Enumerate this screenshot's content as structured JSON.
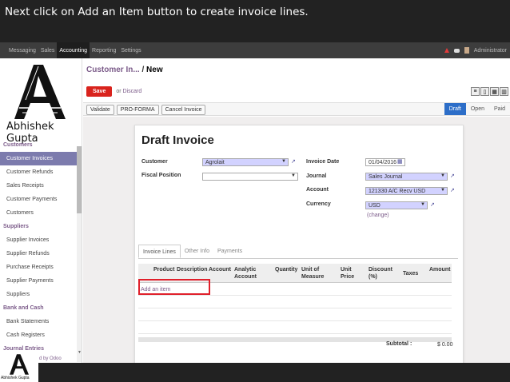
{
  "slide": {
    "instruction": "Next click on Add an Item button to create invoice lines."
  },
  "topbar": {
    "menu": [
      "Messaging",
      "Sales",
      "Accounting",
      "Reporting",
      "Settings"
    ],
    "user": "Administrator"
  },
  "logo": {
    "text": "Abhishek Gupta",
    "small_text": "Abhishek Gupta"
  },
  "sidebar": {
    "sections": [
      {
        "title": "Customers",
        "items": [
          "Customer Invoices",
          "Customer Refunds",
          "Sales Receipts",
          "Customer Payments",
          "Customers"
        ]
      },
      {
        "title": "Suppliers",
        "items": [
          "Supplier Invoices",
          "Supplier Refunds",
          "Purchase Receipts",
          "Supplier Payments",
          "Suppliers"
        ]
      },
      {
        "title": "Bank and Cash",
        "items": [
          "Bank Statements",
          "Cash Registers"
        ]
      },
      {
        "title": "Journal Entries",
        "items": []
      }
    ],
    "powered": "d by Odoo"
  },
  "breadcrumb": {
    "parent": "Customer In...",
    "sep": " / ",
    "current": "New"
  },
  "actions": {
    "save": "Save",
    "or": "or",
    "discard": "Discard"
  },
  "statusbar": {
    "buttons": [
      "Validate",
      "PRO-FORMA",
      "Cancel Invoice"
    ],
    "stages": [
      "Draft",
      "Open",
      "Paid"
    ]
  },
  "form": {
    "title": "Draft Invoice",
    "customer_label": "Customer",
    "customer_value": "Agrolait",
    "fiscal_label": "Fiscal Position",
    "fiscal_value": "",
    "invoice_date_label": "Invoice Date",
    "invoice_date_value": "01/04/2016",
    "journal_label": "Journal",
    "journal_value": "Sales Journal",
    "account_label": "Account",
    "account_value": "121330 A/C Recv USD",
    "currency_label": "Currency",
    "currency_value": "USD",
    "change_link": "(change)"
  },
  "tabs": [
    "Invoice Lines",
    "Other Info",
    "Payments"
  ],
  "lines_table": {
    "headers": [
      "Product",
      "Description",
      "Account",
      "Analytic Account",
      "Quantity",
      "Unit of Measure",
      "Unit Price",
      "Discount (%)",
      "Taxes",
      "Amount"
    ],
    "add_item": "Add an item"
  },
  "totals": {
    "subtotal_label": "Subtotal :",
    "subtotal_value": "$ 0.00"
  },
  "colors": {
    "accent": "#7c5c8a",
    "save": "#d9231d",
    "highlight": "#e0202b",
    "stage_current": "#2d6ec8"
  }
}
